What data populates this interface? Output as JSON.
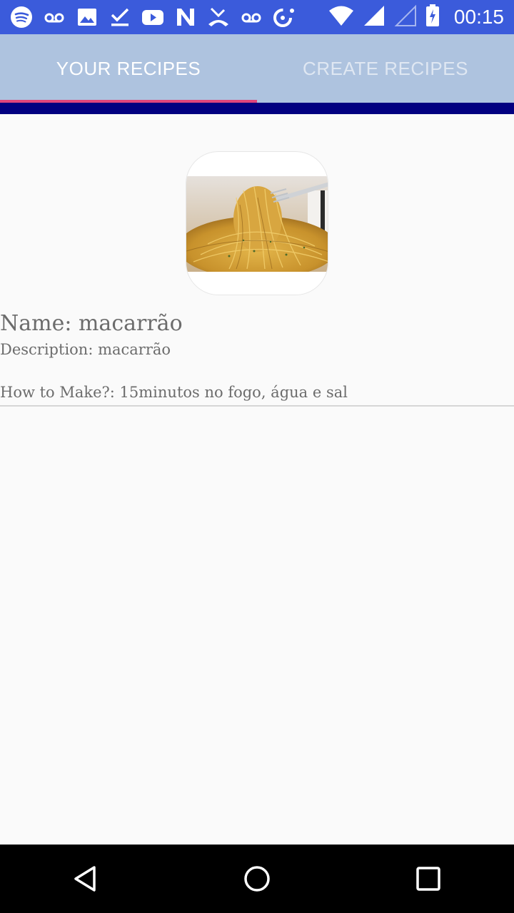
{
  "status_bar": {
    "time": "00:15",
    "icons": [
      "spotify-icon",
      "voicemail-icon",
      "image-icon",
      "task-check-icon",
      "youtube-icon",
      "n-icon",
      "missed-call-icon",
      "voicemail-icon",
      "data-saver-icon",
      "wifi-icon",
      "signal-icon",
      "signal-empty-icon",
      "battery-icon"
    ]
  },
  "tabs": [
    {
      "label": "YOUR RECIPES",
      "active": true
    },
    {
      "label": "CREATE RECIPES",
      "active": false
    }
  ],
  "colors": {
    "status_bar": "#3b5bdb",
    "tab_bar": "#aec3df",
    "tab_indicator": "#e0457b",
    "navy_bar": "#020080",
    "text": "#6c6c6c"
  },
  "recipe": {
    "image": "spaghetti-photo",
    "name": "Name: macarrão",
    "description": "Description: macarrão",
    "how_to_make": "How to Make?: 15minutos no fogo, água e sal"
  },
  "nav_bar": {
    "buttons": [
      "back-icon",
      "home-icon",
      "recents-icon"
    ]
  }
}
